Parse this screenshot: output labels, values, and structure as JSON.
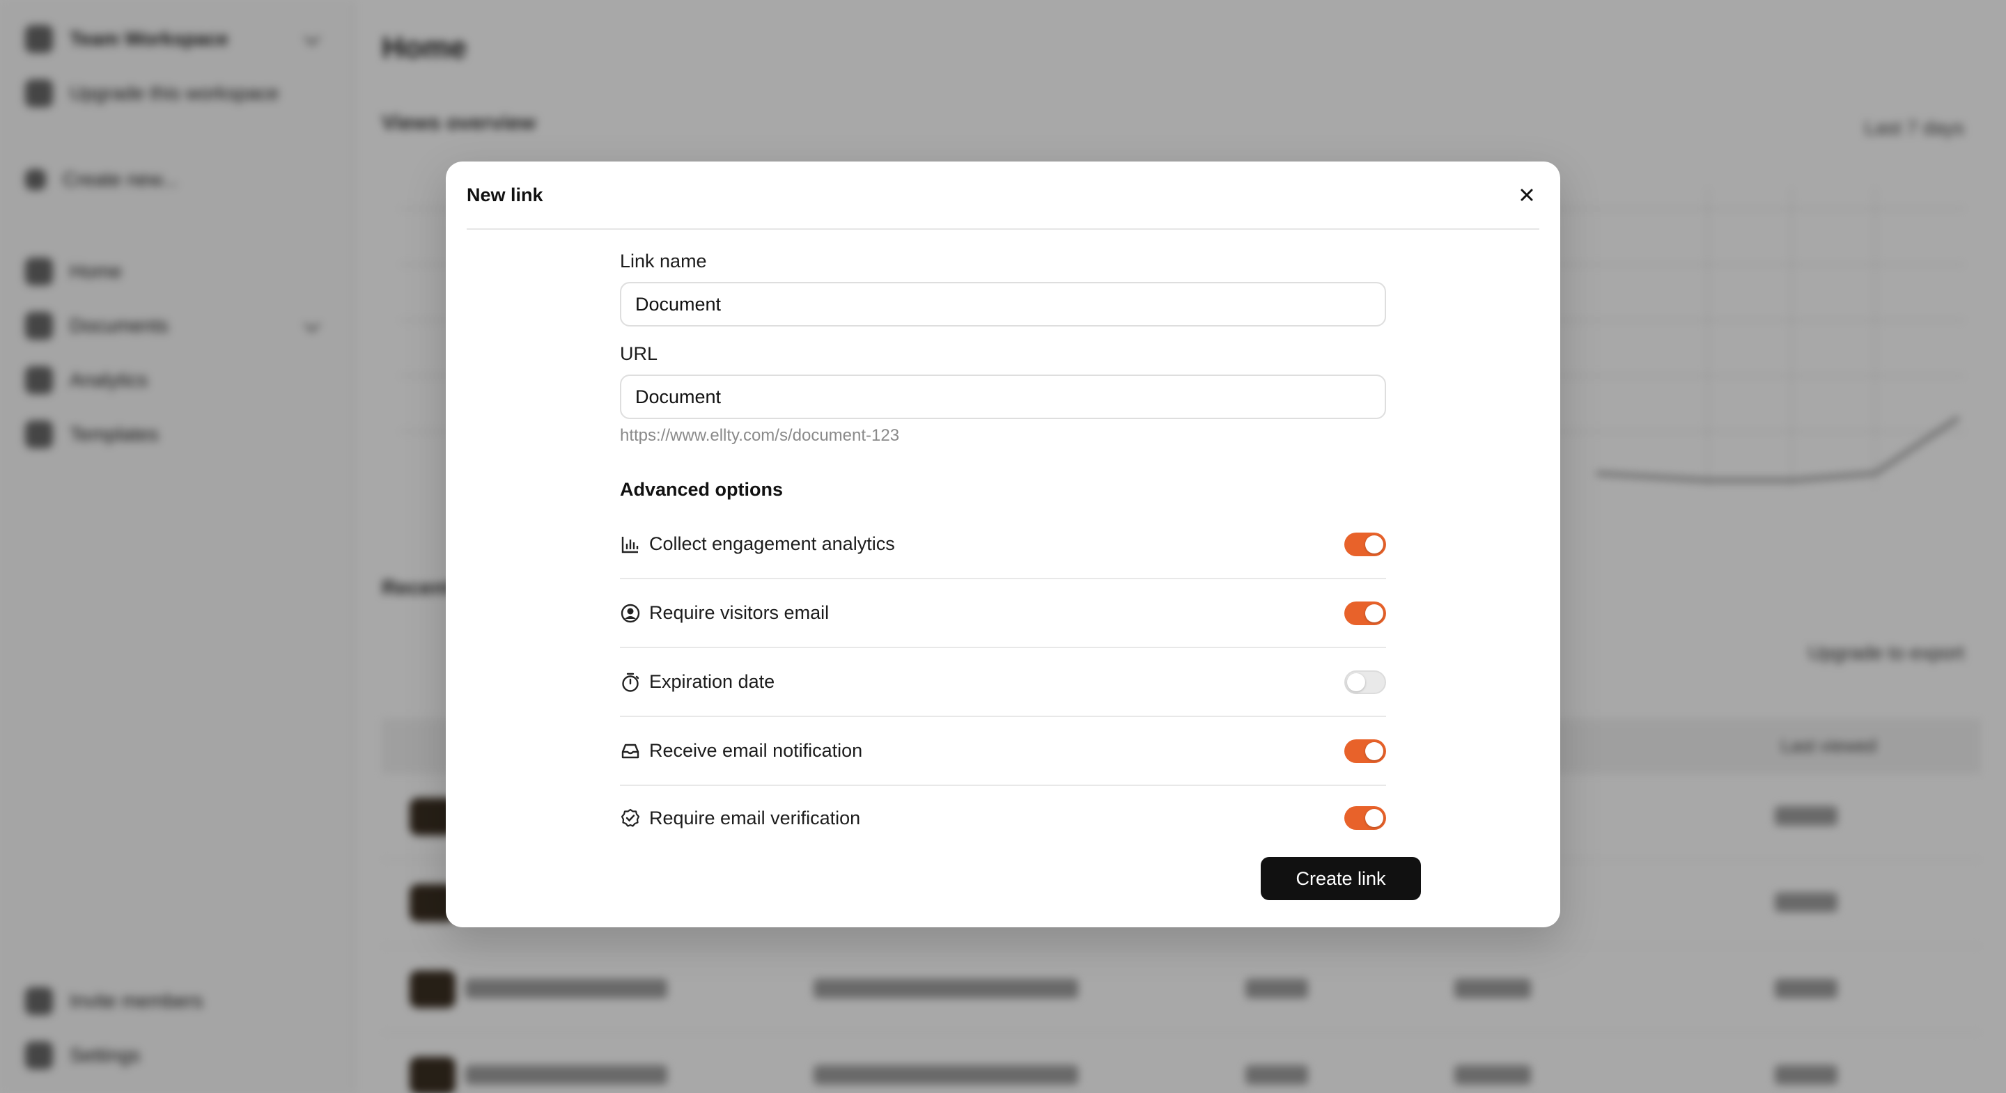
{
  "background": {
    "workspace_name": "Team Workspace",
    "upgrade_workspace": "Upgrade this workspace",
    "create_new": "Create new...",
    "nav": [
      "Home",
      "Documents",
      "Analytics",
      "Templates"
    ],
    "bottom_nav": [
      "Invite members",
      "Settings"
    ],
    "page_title": "Home",
    "chart_title": "Views overview",
    "range": "Last 7 days",
    "section_title": "Recent documents",
    "upgrade_to_export": "Upgrade to export",
    "last_viewed": "Last viewed"
  },
  "modal": {
    "title": "New link",
    "link_name_label": "Link name",
    "link_name_value": "Document",
    "url_label": "URL",
    "url_value": "Document",
    "url_hint": "https://www.ellty.com/s/document-123",
    "advanced_title": "Advanced options",
    "options": [
      {
        "label": "Collect engagement analytics",
        "icon": "bar-chart-icon",
        "enabled": true
      },
      {
        "label": "Require visitors email",
        "icon": "user-circle-icon",
        "enabled": true
      },
      {
        "label": "Expiration date",
        "icon": "timer-icon",
        "enabled": false
      },
      {
        "label": "Receive email notification",
        "icon": "inbox-icon",
        "enabled": true
      },
      {
        "label": "Require email verification",
        "icon": "verified-badge-icon",
        "enabled": true
      }
    ],
    "create_button": "Create link"
  },
  "colors": {
    "accent": "#e8622a",
    "button_dark": "#111111"
  }
}
